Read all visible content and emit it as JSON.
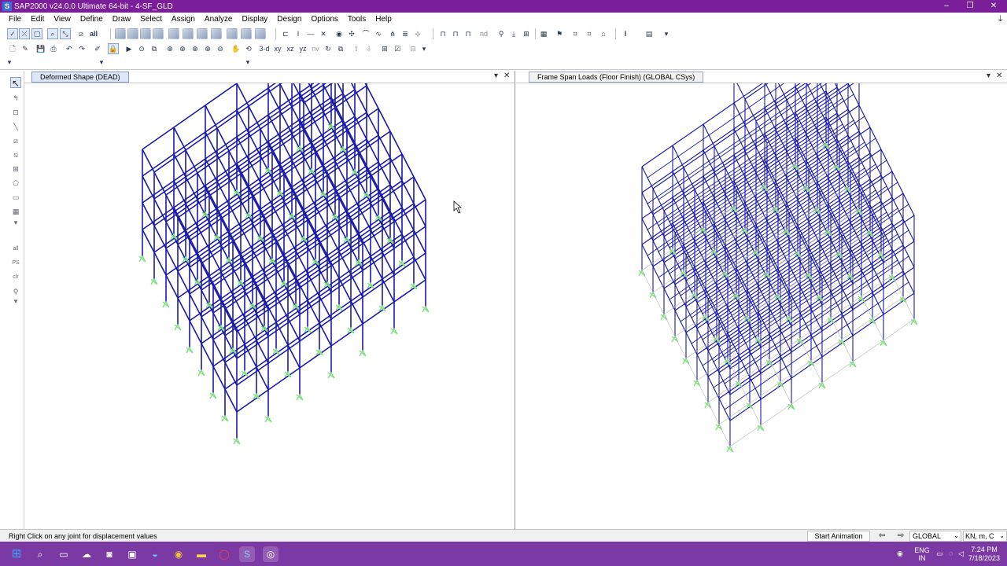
{
  "window": {
    "app_icon": "S",
    "title": "SAP2000 v24.0.0 Ultimate 64-bit - 4-SF_GLD",
    "minimize_glyph": "–",
    "restore_glyph": "❐",
    "close_glyph": "✕"
  },
  "menu": [
    "File",
    "Edit",
    "View",
    "Define",
    "Draw",
    "Select",
    "Assign",
    "Analyze",
    "Display",
    "Design",
    "Options",
    "Tools",
    "Help"
  ],
  "toolbar": {
    "view_3d": "3-d",
    "view_xy": "xy",
    "view_xz": "xz",
    "view_yz": "yz",
    "view_nv": "nv",
    "all_label": "all",
    "nd_label": "nd",
    "ps_label": "PS",
    "clr_label": "clr"
  },
  "panes": {
    "left": {
      "title": "Deformed Shape (DEAD)"
    },
    "right": {
      "title": "Frame Span Loads (Floor Finish) (GLOBAL CSys)"
    },
    "dropdown_glyph": "▾",
    "close_glyph": "✕"
  },
  "statusbar": {
    "message": "Right Click on any joint for displacement values",
    "animation_button": "Start Animation",
    "prev_glyph": "⇦",
    "next_glyph": "⇨",
    "coordinate_system": "GLOBAL",
    "units": "KN, m, C",
    "chevron": "⌄"
  },
  "taskbar": {
    "language": "ENG",
    "region": "IN",
    "time": "7:24 PM",
    "date": "7/18/2023"
  },
  "colors": {
    "titlebar": "#7a1e9a",
    "frame_members": "#1a1aa8",
    "supports": "#7fe07f",
    "taskbar": "#7b3aa3"
  }
}
